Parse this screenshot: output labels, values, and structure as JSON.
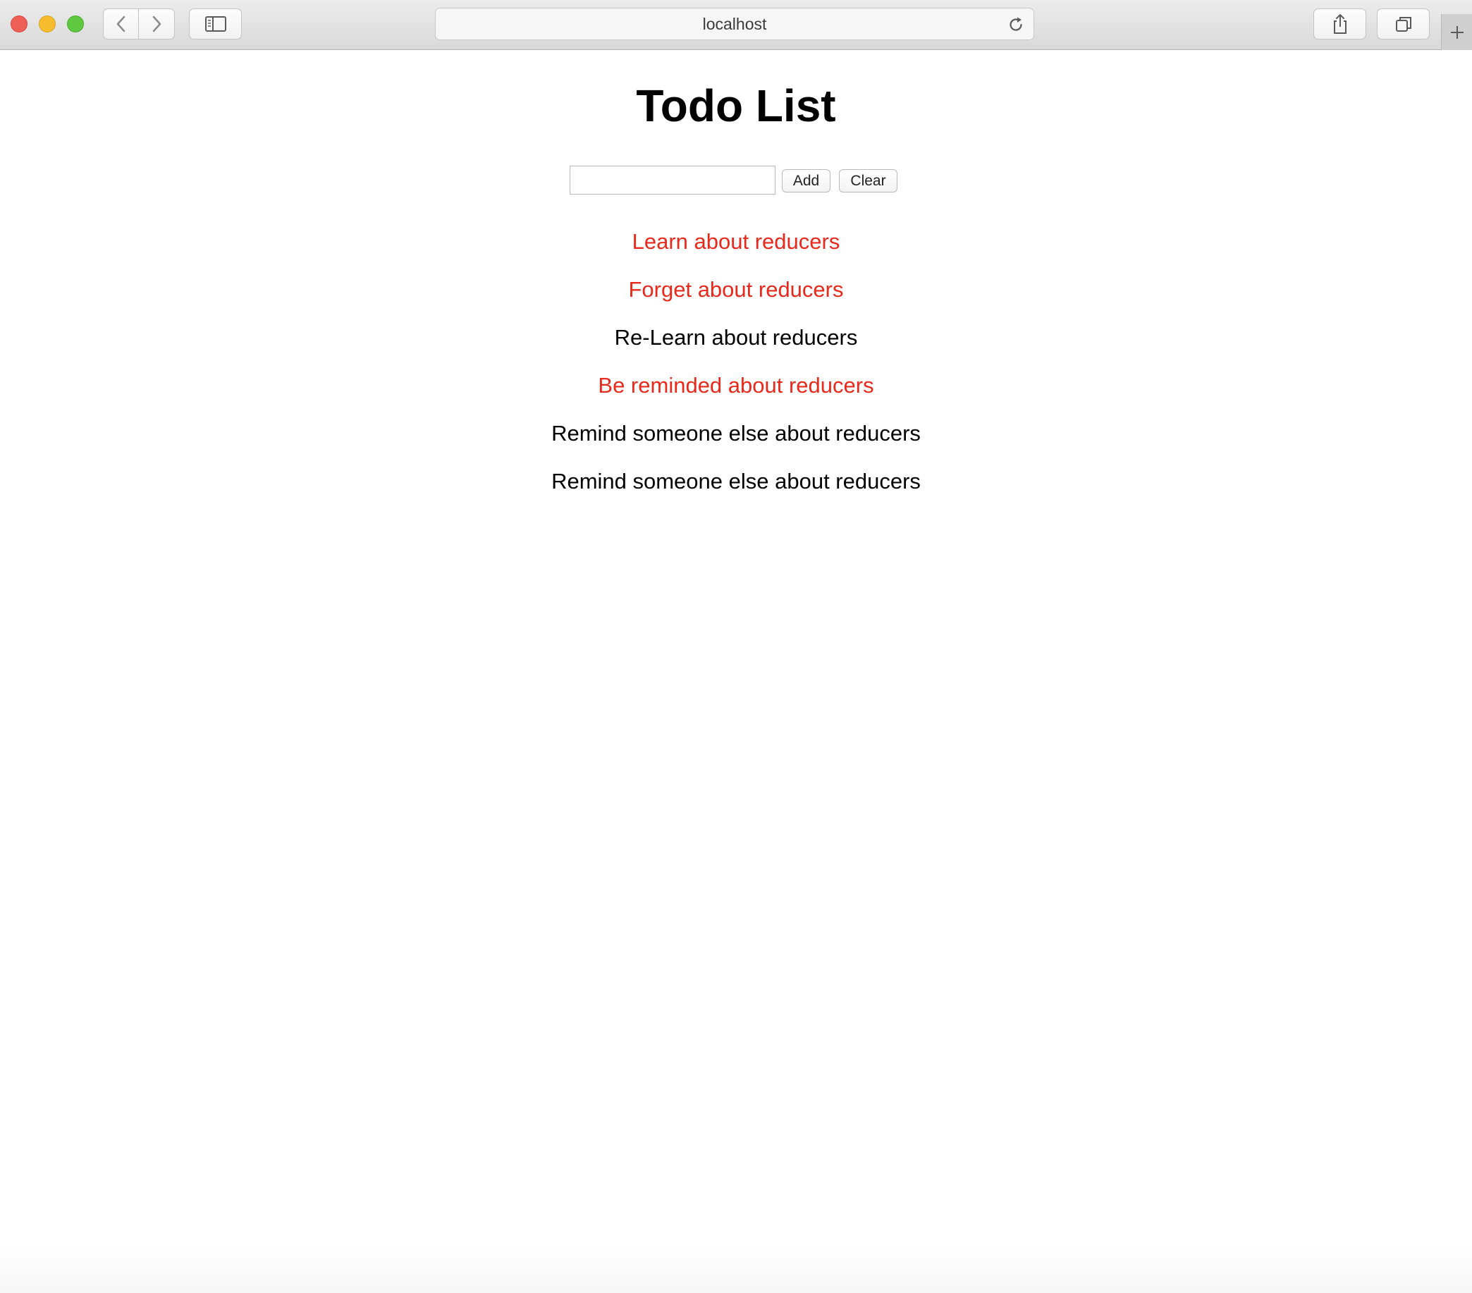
{
  "browser": {
    "url": "localhost",
    "icons": {
      "back": "chevron-left-icon",
      "forward": "chevron-right-icon",
      "sidebar": "sidebar-icon",
      "reload": "reload-icon",
      "share": "share-icon",
      "tabs": "tabs-overview-icon",
      "new_tab": "plus-icon"
    }
  },
  "app": {
    "title": "Todo List",
    "input": {
      "value": "",
      "placeholder": ""
    },
    "add_label": "Add",
    "clear_label": "Clear",
    "todos": [
      {
        "text": "Learn about reducers",
        "completed": true
      },
      {
        "text": "Forget about reducers",
        "completed": true
      },
      {
        "text": "Re-Learn about reducers",
        "completed": false
      },
      {
        "text": "Be reminded about reducers",
        "completed": true
      },
      {
        "text": "Remind someone else about reducers",
        "completed": false
      },
      {
        "text": "Remind someone else about reducers",
        "completed": false
      }
    ]
  },
  "colors": {
    "completed": "#e8291c",
    "active": "#000000"
  }
}
